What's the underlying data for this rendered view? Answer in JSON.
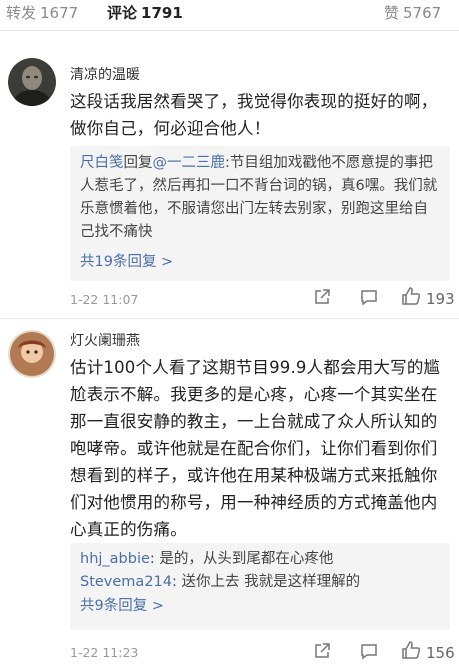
{
  "tabs": [
    {
      "label": "转发",
      "count": "1677"
    },
    {
      "label": "评论",
      "count": "1791"
    },
    {
      "label": "赞",
      "count": "5767"
    }
  ],
  "comments": [
    {
      "user": "清凉的温暖",
      "text": "这段话我居然看哭了，我觉得你表现的挺好的啊，做你自己，何必迎合他人！",
      "reply": {
        "author": "尺白笺",
        "mid": "回复",
        "target": "@一二三鹿",
        "text": ":节目组加戏戳他不愿意提的事把人惹毛了，然后再扣一口不背台词的锅，真6嘿。我们就乐意惯着他，不服请您出门左转去别家，别跑这里给自己找不痛快"
      },
      "more": "共19条回复 >",
      "time": "1-22 11:07",
      "likes": "193"
    },
    {
      "user": "灯火阑珊燕",
      "text": "估计100个人看了这期节目99.9人都会用大写的尴尬表示不解。我更多的是心疼，心疼一个其实坐在那一直很安静的教主，一上台就成了众人所认知的咆哮帝。或许他就是在配合你们，让你们看到你们想看到的样子，或许他在用某种极端方式来抵触你们对他惯用的称号，用一种神经质的方式掩盖他内心真正的伤痛。",
      "replies": [
        {
          "author": "hhj_abbie",
          "text": ": 是的，从头到尾都在心疼他"
        },
        {
          "author": "Stevema214",
          "text": ": 送你上去 我就是这样理解的"
        }
      ],
      "more": "共9条回复 >",
      "time": "1-22 11:23",
      "likes": "156"
    }
  ],
  "colors": {
    "accent": "#ff8200",
    "link": "#4a6fa8"
  }
}
